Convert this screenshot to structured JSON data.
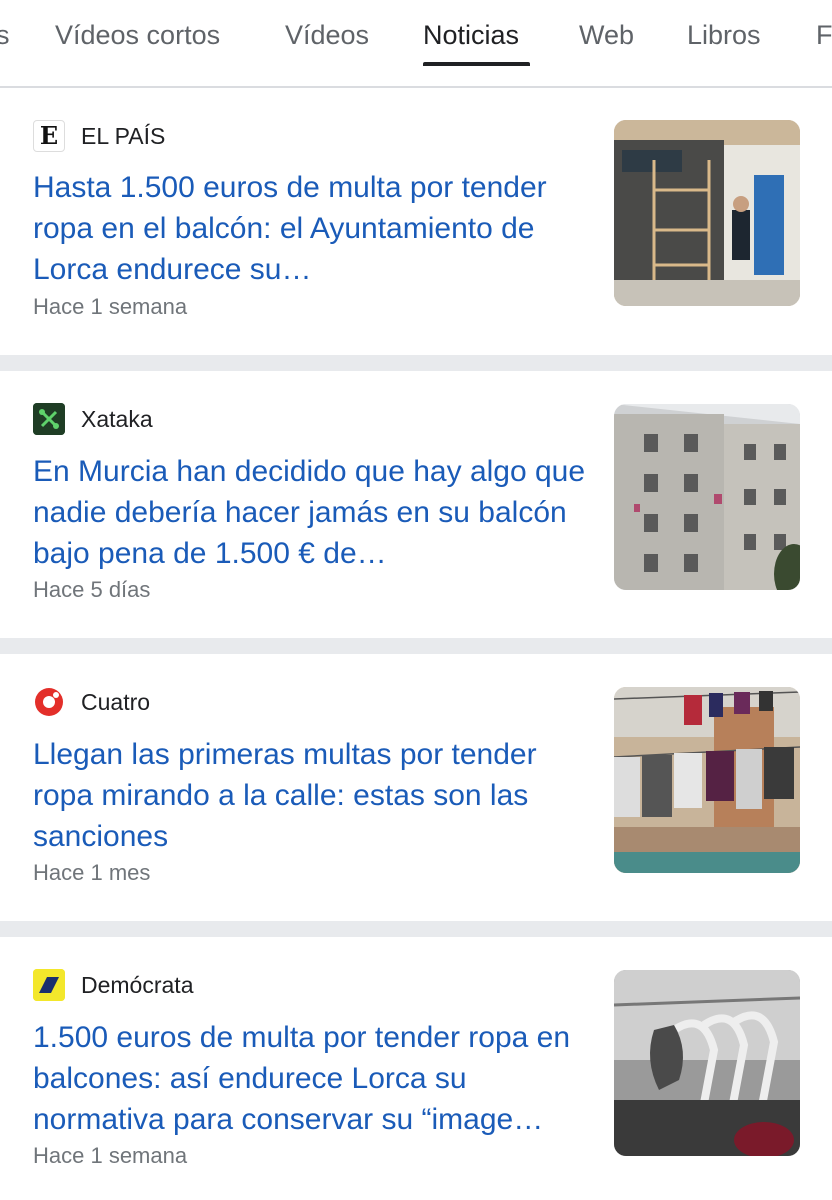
{
  "tabs": [
    {
      "label": "s"
    },
    {
      "label": "Vídeos cortos"
    },
    {
      "label": "Vídeos"
    },
    {
      "label": "Noticias"
    },
    {
      "label": "Web"
    },
    {
      "label": "Libros"
    },
    {
      "label": "F"
    }
  ],
  "active_tab": "Noticias",
  "colors": {
    "headline": "#1a5bb8",
    "meta": "#70757a",
    "separator": "#e8eaed",
    "active_underline": "#202124"
  },
  "articles": [
    {
      "source": "EL PAÍS",
      "source_icon": "el-pais-logo-icon",
      "headline": "Hasta 1.500 euros de multa por tender ropa en el balcón: el Ayuntamiento de Lorca endurece su…",
      "time": "Hace 1 semana",
      "thumbnail": "storefront-scaffolding-photo"
    },
    {
      "source": "Xataka",
      "source_icon": "xataka-logo-icon",
      "headline": "En Murcia han decidido que hay algo que nadie debería hacer jamás en su balcón bajo pena de 1.500 € de…",
      "time": "Hace 5 días",
      "thumbnail": "apartment-building-balconies-photo"
    },
    {
      "source": "Cuatro",
      "source_icon": "cuatro-logo-icon",
      "headline": "Llegan las primeras multas por tender ropa mirando a la calle: estas son las sanciones",
      "time": "Hace 1 mes",
      "thumbnail": "clothesline-laundry-photo"
    },
    {
      "source": "Demócrata",
      "source_icon": "democrata-logo-icon",
      "headline": "1.500 euros de multa por tender ropa en balcones: así endurece Lorca su normativa para conservar su “image…",
      "time": "Hace 1 semana",
      "thumbnail": "clothes-hangers-photo"
    }
  ]
}
